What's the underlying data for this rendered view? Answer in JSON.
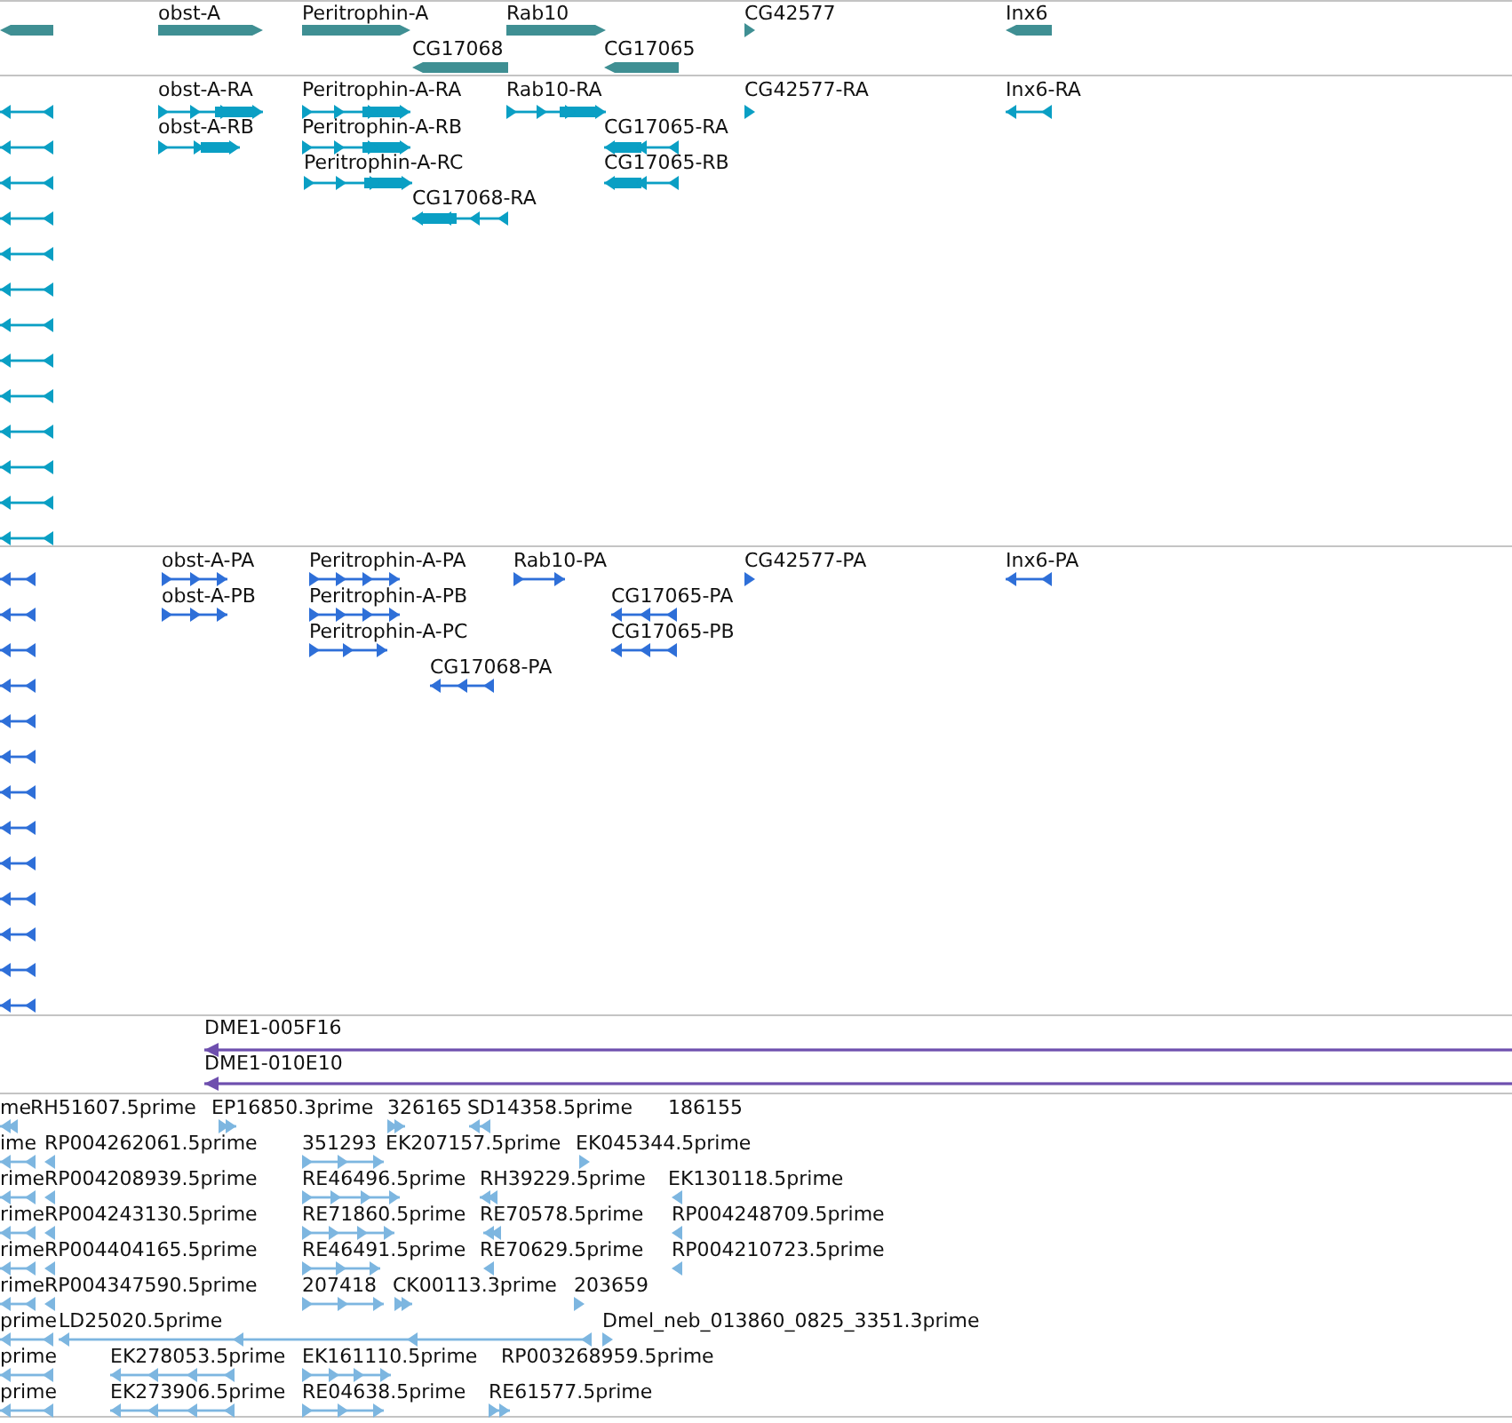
{
  "tracks": [
    {
      "kind": "gene",
      "unlabeled_features": [
        {
          "reverse": true
        }
      ],
      "features": [
        {
          "label": "obst-A",
          "reverse": false
        },
        {
          "label": "Peritrophin-A",
          "reverse": false
        },
        {
          "label": "Rab10",
          "reverse": false
        },
        {
          "label": "CG42577",
          "reverse": false
        },
        {
          "label": "Inx6",
          "reverse": true
        },
        {
          "label": "CG17068",
          "reverse": true
        },
        {
          "label": "CG17065",
          "reverse": true
        }
      ]
    },
    {
      "kind": "transcript",
      "unlabeled_features": [
        {
          "reverse": true
        },
        {
          "reverse": true
        },
        {
          "reverse": true
        },
        {
          "reverse": true
        },
        {
          "reverse": true
        },
        {
          "reverse": true
        },
        {
          "reverse": true
        },
        {
          "reverse": true
        },
        {
          "reverse": true
        },
        {
          "reverse": true
        },
        {
          "reverse": true
        },
        {
          "reverse": true
        },
        {
          "reverse": true
        }
      ],
      "features": [
        {
          "label": "obst-A-RA",
          "reverse": false
        },
        {
          "label": "Peritrophin-A-RA",
          "reverse": false
        },
        {
          "label": "Rab10-RA",
          "reverse": false
        },
        {
          "label": "CG42577-RA",
          "reverse": false
        },
        {
          "label": "Inx6-RA",
          "reverse": true
        },
        {
          "label": "obst-A-RB",
          "reverse": false
        },
        {
          "label": "Peritrophin-A-RB",
          "reverse": false
        },
        {
          "label": "CG17065-RA",
          "reverse": true
        },
        {
          "label": "Peritrophin-A-RC",
          "reverse": false
        },
        {
          "label": "CG17065-RB",
          "reverse": true
        },
        {
          "label": "CG17068-RA",
          "reverse": true
        }
      ]
    },
    {
      "kind": "protein",
      "unlabeled_features": [
        {
          "reverse": true
        },
        {
          "reverse": true
        },
        {
          "reverse": true
        },
        {
          "reverse": true
        },
        {
          "reverse": true
        },
        {
          "reverse": true
        },
        {
          "reverse": true
        },
        {
          "reverse": true
        },
        {
          "reverse": true
        },
        {
          "reverse": true
        },
        {
          "reverse": true
        },
        {
          "reverse": true
        },
        {
          "reverse": true
        }
      ],
      "features": [
        {
          "label": "obst-A-PA",
          "reverse": false
        },
        {
          "label": "Peritrophin-A-PA",
          "reverse": false
        },
        {
          "label": "Rab10-PA",
          "reverse": false
        },
        {
          "label": "CG42577-PA",
          "reverse": false
        },
        {
          "label": "Inx6-PA",
          "reverse": true
        },
        {
          "label": "obst-A-PB",
          "reverse": false
        },
        {
          "label": "Peritrophin-A-PB",
          "reverse": false
        },
        {
          "label": "CG17065-PA",
          "reverse": true
        },
        {
          "label": "Peritrophin-A-PC",
          "reverse": false
        },
        {
          "label": "CG17065-PB",
          "reverse": true
        },
        {
          "label": "CG17068-PA",
          "reverse": true
        }
      ]
    },
    {
      "kind": "clone",
      "features": [
        {
          "label": "DME1-005F16",
          "reverse": true
        },
        {
          "label": "DME1-010E10",
          "reverse": true
        }
      ]
    },
    {
      "kind": "est",
      "rows": [
        {
          "features": [
            {
              "label": "me",
              "reverse": true
            },
            {
              "label": "RH51607.5prime"
            },
            {
              "label": "EP16850.3prime",
              "reverse": false
            },
            {
              "label": "326165",
              "reverse": false
            },
            {
              "label": "SD14358.5prime",
              "reverse": true
            },
            {
              "label": "186155"
            }
          ]
        },
        {
          "features": [
            {
              "label": "ime",
              "reverse": true
            },
            {
              "label": "RP004262061.5prime",
              "reverse": true
            },
            {
              "label": "351293",
              "reverse": false
            },
            {
              "label": "EK207157.5prime"
            },
            {
              "label": "EK045344.5prime",
              "reverse": false
            }
          ]
        },
        {
          "features": [
            {
              "label": "rime",
              "reverse": true
            },
            {
              "label": "RP004208939.5prime",
              "reverse": true
            },
            {
              "label": "RE46496.5prime",
              "reverse": false
            },
            {
              "label": "RH39229.5prime",
              "reverse": true
            },
            {
              "label": "EK130118.5prime",
              "reverse": true
            }
          ]
        },
        {
          "features": [
            {
              "label": "rime",
              "reverse": true
            },
            {
              "label": "RP004243130.5prime",
              "reverse": true
            },
            {
              "label": "RE71860.5prime",
              "reverse": false
            },
            {
              "label": "RE70578.5prime",
              "reverse": true
            },
            {
              "label": "RP004248709.5prime",
              "reverse": true
            }
          ]
        },
        {
          "features": [
            {
              "label": "rime",
              "reverse": true
            },
            {
              "label": "RP004404165.5prime",
              "reverse": true
            },
            {
              "label": "RE46491.5prime",
              "reverse": false
            },
            {
              "label": "RE70629.5prime",
              "reverse": true
            },
            {
              "label": "RP004210723.5prime",
              "reverse": true
            }
          ]
        },
        {
          "features": [
            {
              "label": "rime",
              "reverse": true
            },
            {
              "label": "RP004347590.5prime",
              "reverse": true
            },
            {
              "label": "207418",
              "reverse": false
            },
            {
              "label": "CK00113.3prime",
              "reverse": false
            },
            {
              "label": "203659",
              "reverse": false
            }
          ]
        },
        {
          "features": [
            {
              "label": "prime",
              "reverse": true
            },
            {
              "label": "LD25020.5prime",
              "reverse": true
            },
            {
              "label": "Dmel_neb_013860_0825_3351.3prime",
              "reverse": false
            }
          ]
        },
        {
          "features": [
            {
              "label": "prime",
              "reverse": true
            },
            {
              "label": "EK278053.5prime",
              "reverse": true
            },
            {
              "label": "EK161110.5prime",
              "reverse": false
            },
            {
              "label": "RP003268959.5prime"
            }
          ]
        },
        {
          "features": [
            {
              "label": "prime",
              "reverse": true
            },
            {
              "label": "EK273906.5prime",
              "reverse": true
            },
            {
              "label": "RE04638.5prime",
              "reverse": false
            },
            {
              "label": "RE61577.5prime",
              "reverse": false
            }
          ]
        }
      ]
    }
  ]
}
